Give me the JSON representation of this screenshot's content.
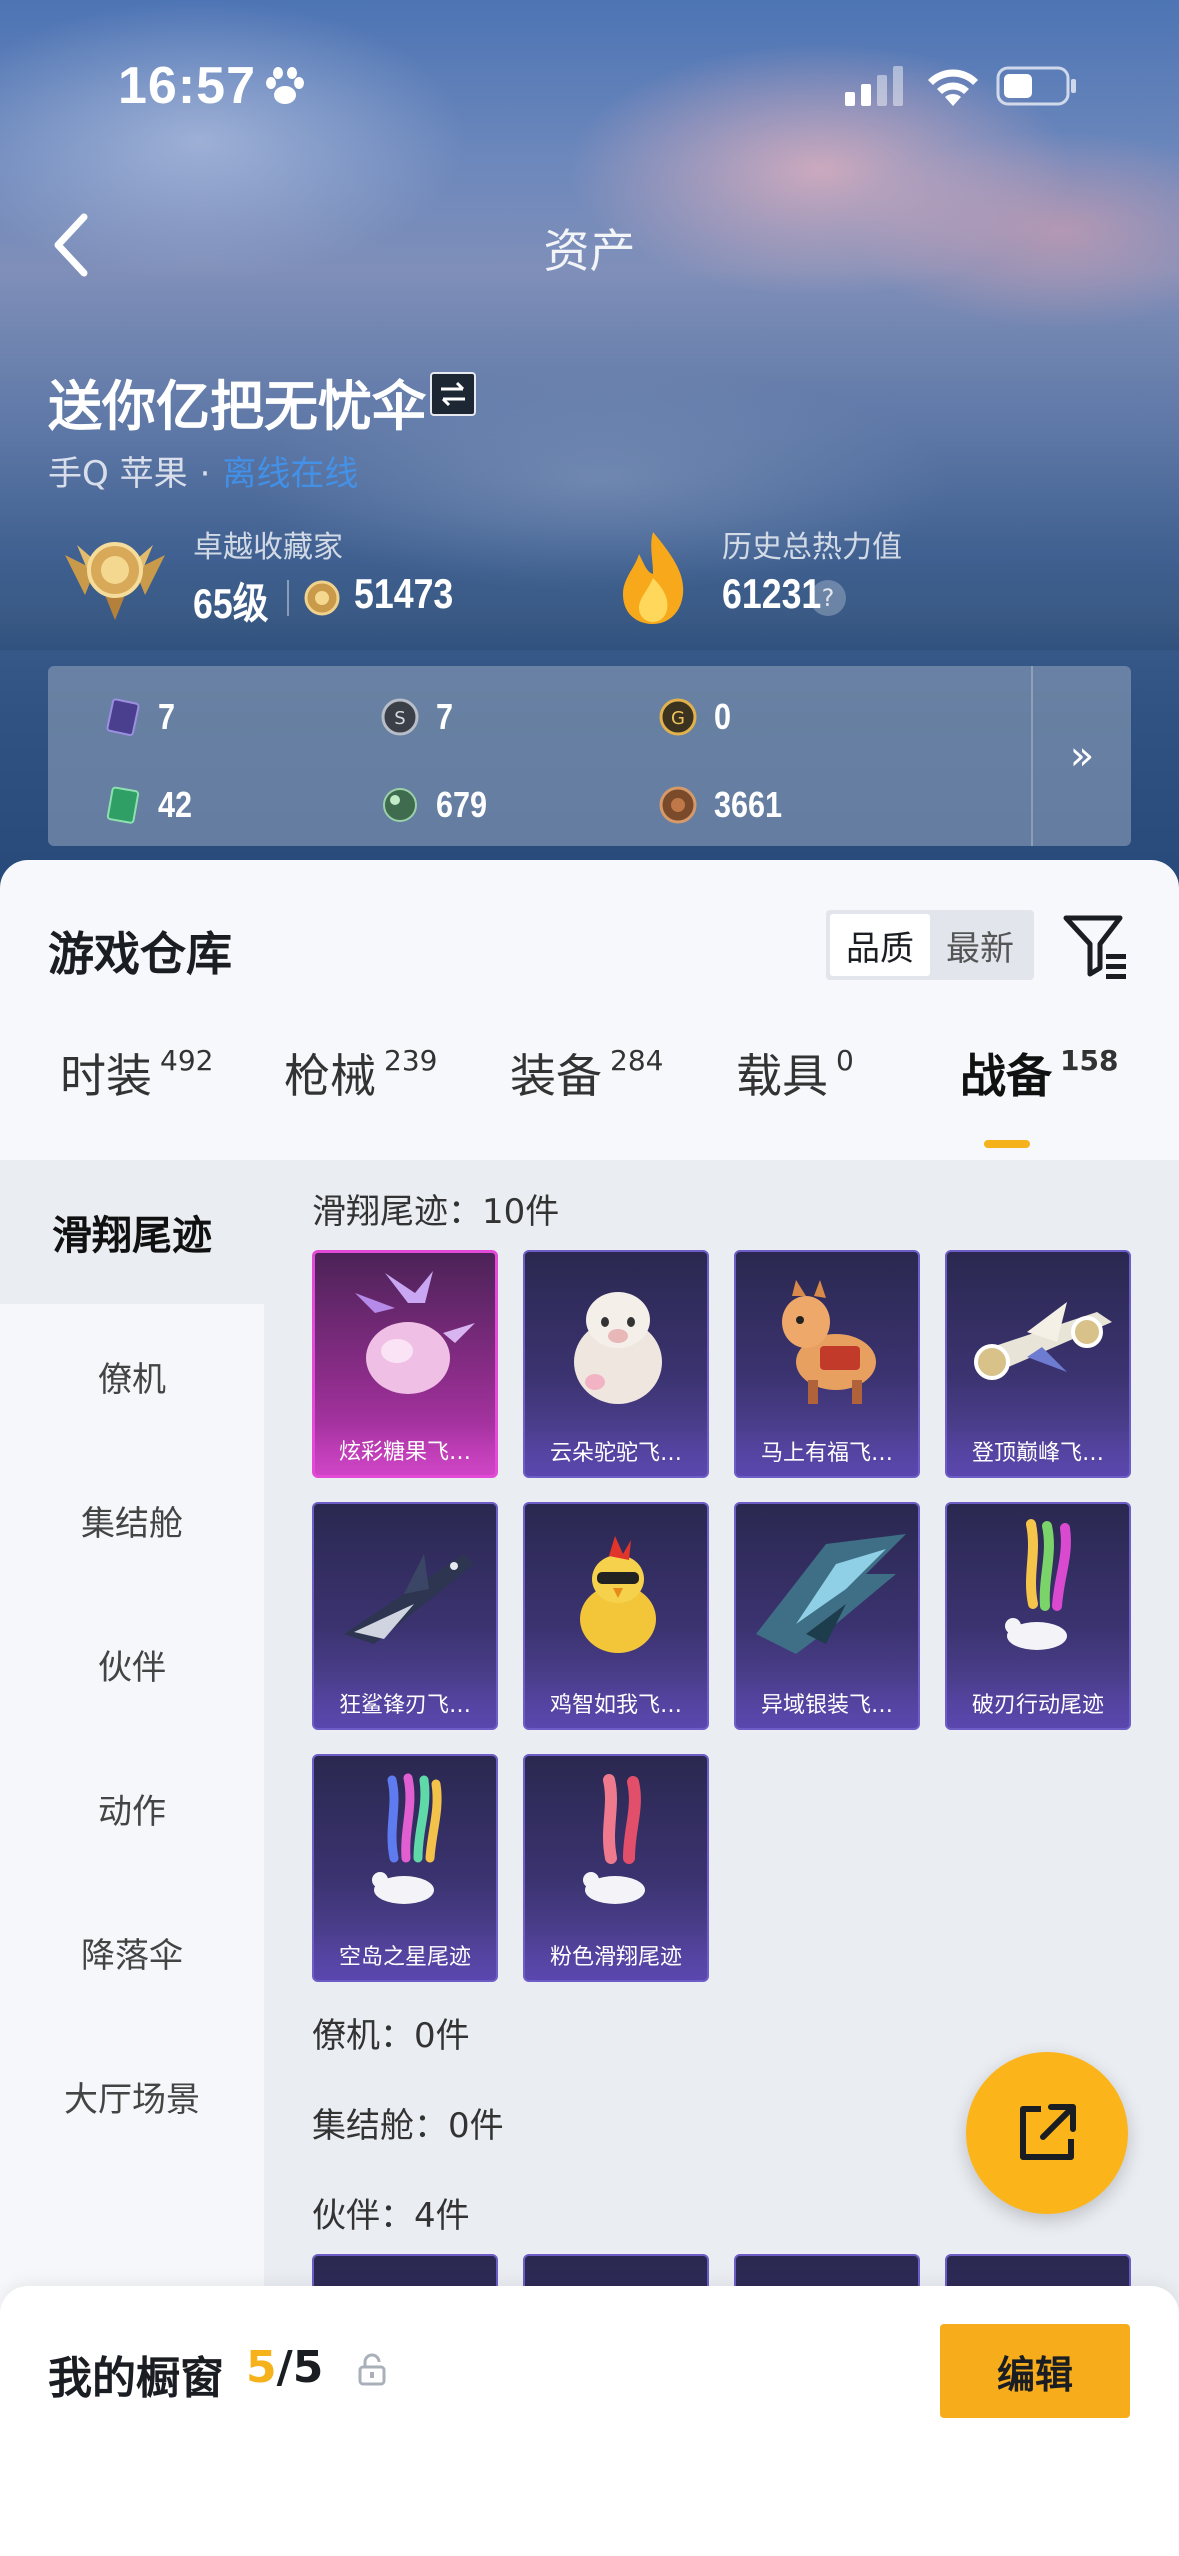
{
  "status_bar": {
    "time": "16:57"
  },
  "nav": {
    "title": "资产"
  },
  "profile": {
    "name": "送你亿把无忧伞",
    "platform": "手Q 苹果",
    "separator": "·",
    "online_status": "离线在线"
  },
  "stats": {
    "collector_title": "卓越收藏家",
    "level": "65级",
    "medal_value": "51473",
    "heat_title": "历史总热力值",
    "heat_value": "61231",
    "help_symbol": "?"
  },
  "currencies": [
    {
      "icon": "purple-card-icon",
      "value": "7"
    },
    {
      "icon": "silver-coin-icon",
      "value": "7"
    },
    {
      "icon": "gold-coin-icon",
      "value": "0"
    },
    {
      "icon": "green-ticket-icon",
      "value": "42"
    },
    {
      "icon": "green-orb-icon",
      "value": "679"
    },
    {
      "icon": "bronze-coin-icon",
      "value": "3661"
    }
  ],
  "currency_more": "»",
  "warehouse": {
    "title": "游戏仓库",
    "sort_options": [
      "品质",
      "最新"
    ],
    "sort_active": "品质"
  },
  "tabs": [
    {
      "label": "时装",
      "count": "492"
    },
    {
      "label": "枪械",
      "count": "239"
    },
    {
      "label": "装备",
      "count": "284"
    },
    {
      "label": "载具",
      "count": "0"
    },
    {
      "label": "战备",
      "count": "158",
      "active": true
    }
  ],
  "sidebar": [
    "滑翔尾迹",
    "僚机",
    "集结舱",
    "伙伴",
    "动作",
    "降落伞",
    "大厅场景"
  ],
  "sections": {
    "glide_trail": "滑翔尾迹：10件",
    "wingman": "僚机：0件",
    "assembly": "集结舱：0件",
    "partner": "伙伴：4件"
  },
  "items": [
    {
      "label": "炫彩糖果飞…",
      "art": "candy-icon"
    },
    {
      "label": "云朵驼驼飞…",
      "art": "alpaca-icon"
    },
    {
      "label": "马上有福飞…",
      "art": "horse-icon"
    },
    {
      "label": "登顶巅峰飞…",
      "art": "jet-icon"
    },
    {
      "label": "狂鲨锋刃飞…",
      "art": "shark-icon"
    },
    {
      "label": "鸡智如我飞…",
      "art": "chicken-icon"
    },
    {
      "label": "异域银装飞…",
      "art": "wing-icon"
    },
    {
      "label": "破刃行动尾迹",
      "art": "smoke-trail-icon"
    },
    {
      "label": "空岛之星尾迹",
      "art": "rainbow-trail-icon"
    },
    {
      "label": "粉色滑翔尾迹",
      "art": "pink-trail-icon"
    }
  ],
  "showcase": {
    "label": "我的橱窗",
    "current": "5",
    "total": "/5"
  },
  "edit_label": "编辑",
  "colors": {
    "accent": "#f6b21a",
    "card_purple": "#3b3370",
    "card_pink": "#c13ab8"
  }
}
